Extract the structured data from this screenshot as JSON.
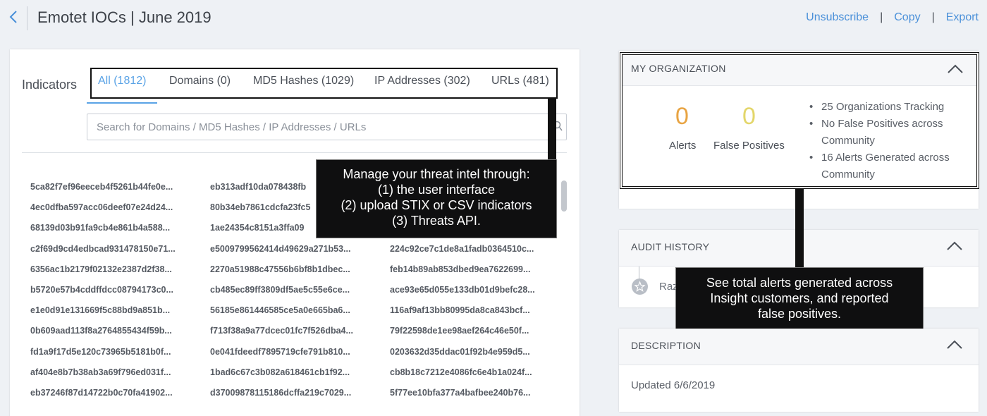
{
  "header": {
    "title": "Emotet IOCs | June 2019",
    "actions": {
      "unsubscribe": "Unsubscribe",
      "copy": "Copy",
      "export": "Export",
      "separator": "|"
    }
  },
  "indicators": {
    "label": "Indicators",
    "tabs": [
      {
        "label": "All (1812)",
        "active": true
      },
      {
        "label": "Domains (0)",
        "active": false
      },
      {
        "label": "MD5 Hashes (1029)",
        "active": false
      },
      {
        "label": "IP Addresses (302)",
        "active": false
      },
      {
        "label": "URLs (481)",
        "active": false
      }
    ],
    "search_placeholder": "Search for Domains / MD5 Hashes / IP Addresses / URLs",
    "hash_rows": [
      [
        "5ca82f7ef96eeceb4f5261b44fe0e...",
        "eb313adf10da078438fb",
        ""
      ],
      [
        "4ec0dfba597acc06deef07e24d24...",
        "80b34eb7861cdcfa23fc5",
        ""
      ],
      [
        "68139d03b91fa9cb4e861b4a588...",
        "1ae24354c8151a3ffa09",
        ""
      ],
      [
        "c2f69d9cd4edbcad931478150e71...",
        "e5009799562414d49629a271b53...",
        "224c92ce7c1de8a1fadb0364510c..."
      ],
      [
        "6356ac1b2179f02132e2387d2f38...",
        "2270a51988c47556b6bf8b1dbec...",
        "feb14b89ab853dbed9ea7622699..."
      ],
      [
        "b5720e57b4cddffdcc08794173c0...",
        "cb485ec89ff3809df5ae5c55e6ce...",
        "ace93e65d055e133db01d9befc28..."
      ],
      [
        "e1e0d91e131669f5c88bd9a851b...",
        "56185e861446585ce5a0e665ba6...",
        "116af9af13bb80995da8ca843bcf..."
      ],
      [
        "0b609aad113f8a2764855434f59b...",
        "f713f38a9a77dcec01fc7f526dba4...",
        "79f22598de1ee98aef264c46e50f..."
      ],
      [
        "fd1a9f17d5e120c73965b5181b0f...",
        "0e041fdeedf7895719cfe791b810...",
        "0203632d35ddac01f92b4e959d5..."
      ],
      [
        "af404e8b7b38ab3a69f796ed031f...",
        "1bad6c67c3b082a618461cb1f92...",
        "cb8b18c7212e4086fc6e4b1a024f..."
      ],
      [
        "eb37246f87d14722b0c70fa41902...",
        "d37009878115186dcffa219c7029...",
        "5f77ee10bfa377a4bafbee240b76..."
      ]
    ]
  },
  "callouts": {
    "threat_intel": [
      "Manage your threat intel through:",
      "(1) the user interface",
      "(2) upload STIX or CSV indicators",
      "(3) Threats API."
    ],
    "alerts": [
      "See total alerts generated across",
      "Insight customers, and reported",
      "false positives."
    ]
  },
  "organization": {
    "title": "MY ORGANIZATION",
    "alerts_value": "0",
    "alerts_label": "Alerts",
    "false_positives_value": "0",
    "false_positives_label": "False Positives",
    "stats": [
      "25 Organizations Tracking",
      "No False Positives across Community",
      "16 Alerts Generated across Community"
    ]
  },
  "audit_history": {
    "title": "AUDIT HISTORY",
    "entry_name": "Raz"
  },
  "description": {
    "title": "DESCRIPTION",
    "text": "Updated 6/6/2019"
  },
  "colors": {
    "accent": "#5aa3e6",
    "link": "#4a90d9",
    "alert": "#e8a443",
    "false_positive": "#e3d66a",
    "callout": "#0f0f10"
  },
  "icons": [
    "back-chevron-icon",
    "search-icon",
    "chevron-up-icon",
    "star-icon"
  ]
}
